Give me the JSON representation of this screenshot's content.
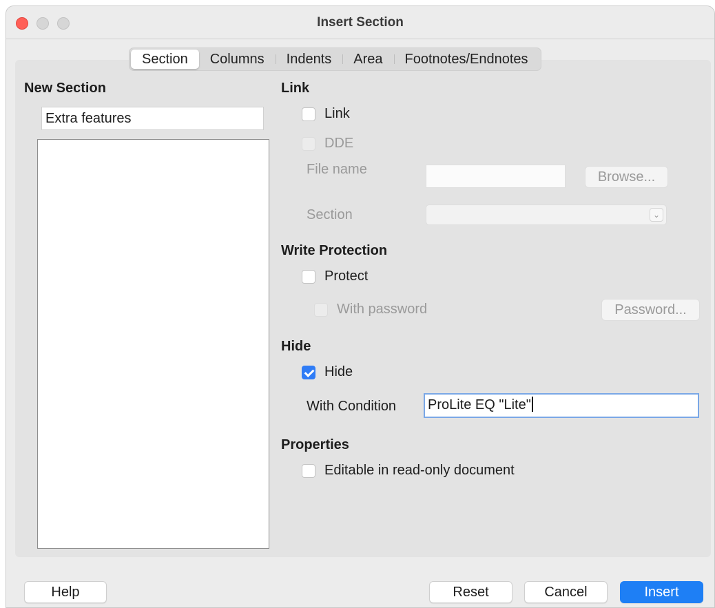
{
  "window": {
    "title": "Insert Section"
  },
  "tabs": [
    {
      "label": "Section",
      "active": true
    },
    {
      "label": "Columns",
      "active": false
    },
    {
      "label": "Indents",
      "active": false
    },
    {
      "label": "Area",
      "active": false
    },
    {
      "label": "Footnotes/Endnotes",
      "active": false
    }
  ],
  "new_section": {
    "heading": "New Section",
    "name_value": "Extra features"
  },
  "link": {
    "heading": "Link",
    "link_label": "Link",
    "link_checked": false,
    "dde_label": "DDE",
    "file_name_label": "File name",
    "file_name_value": "",
    "browse_label": "Browse...",
    "section_label": "Section",
    "section_value": ""
  },
  "write_protection": {
    "heading": "Write Protection",
    "protect_label": "Protect",
    "protect_checked": false,
    "with_password_label": "With password",
    "password_button": "Password..."
  },
  "hide": {
    "heading": "Hide",
    "hide_label": "Hide",
    "hide_checked": true,
    "condition_label": "With Condition",
    "condition_value": "ProLite EQ \"Lite\""
  },
  "properties": {
    "heading": "Properties",
    "editable_label": "Editable in read-only document",
    "editable_checked": false
  },
  "footer": {
    "help": "Help",
    "reset": "Reset",
    "cancel": "Cancel",
    "insert": "Insert"
  },
  "colors": {
    "accent": "#1e7ff5",
    "close_button": "#ff5f57",
    "checkbox_checked": "#2f7cf6"
  }
}
